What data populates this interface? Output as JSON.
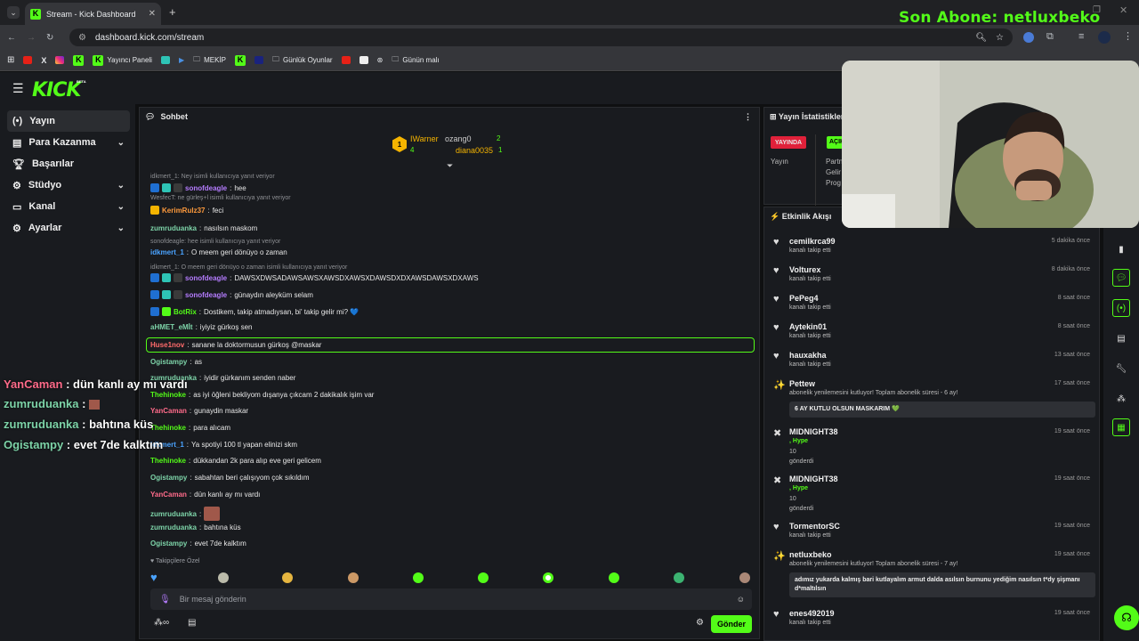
{
  "browser": {
    "tab_title": "Stream - Kick Dashboard",
    "url": "dashboard.kick.com/stream",
    "bookmarks": [
      "Yayıncı Paneli",
      "MEKİP",
      "Günlük Oyunlar",
      "Günün malı"
    ]
  },
  "overlay": {
    "last_sub": "Son Abone: netluxbeko",
    "chat": [
      {
        "user": "YanCaman",
        "text": "dün kanlı ay mı vardı",
        "color": "#ff6b8a"
      },
      {
        "user": "zumruduanka",
        "text": ":",
        "color": "#7dd3a8"
      },
      {
        "user": "zumruduanka",
        "text": "bahtına küs",
        "color": "#7dd3a8"
      },
      {
        "user": "Ogistampy",
        "text": "evet 7de kalktım",
        "color": "#7dd3a8"
      }
    ]
  },
  "kick": {
    "logo": "KICK",
    "logo_tag": "BETA"
  },
  "sidebar": {
    "items": [
      {
        "label": "Yayın",
        "icon": "broadcast-icon"
      },
      {
        "label": "Para Kazanma",
        "icon": "money-icon"
      },
      {
        "label": "Başarılar",
        "icon": "trophy-icon"
      },
      {
        "label": "Stüdyo",
        "icon": "gear-icon"
      },
      {
        "label": "Kanal",
        "icon": "channel-icon"
      },
      {
        "label": "Ayarlar",
        "icon": "settings-icon"
      }
    ]
  },
  "chat": {
    "title": "Sohbet",
    "leaderboard": {
      "rank1_name": "IWarner",
      "rank1_count": "4",
      "rank2_name": "ozang0",
      "rank2_count": "2",
      "rank3_name": "diana0035",
      "rank3_count": "1",
      "rank1_label": "1"
    },
    "messages": [
      {
        "type": "reply",
        "text": "idkmert_1: Ney isimli kullanıcıya yanıt veriyor"
      },
      {
        "type": "msg",
        "user": "sonofdeagle",
        "color": "#b57cff",
        "text": "hee",
        "badges": 3
      },
      {
        "type": "reply",
        "text": "WesfecT: ne gürleş+l isimli kullanıcıya yanıt veriyor"
      },
      {
        "type": "msg",
        "user": "KerimRulz37",
        "color": "#ff9a3c",
        "text": "feci",
        "badges": 1
      },
      {
        "type": "msg",
        "user": "zumruduanka",
        "color": "#7dd3a8",
        "text": "nasılsın maskom",
        "badges": 0
      },
      {
        "type": "reply",
        "text": "sonofdeagle: hee isimli kullanıcıya yanıt veriyor"
      },
      {
        "type": "msg",
        "user": "idkmert_1",
        "color": "#4aa3ff",
        "text": "O meem geri dönüyo o zaman",
        "badges": 0
      },
      {
        "type": "reply",
        "text": "idkmert_1: O meem geri dönüyo o zaman isimli kullanıcıya yanıt veriyor"
      },
      {
        "type": "msg",
        "user": "sonofdeagle",
        "color": "#b57cff",
        "text": "DAWSXDWSADAWSAWSXAWSDXAWSXDAWSDXDXAWSDAWSXDXAWS",
        "badges": 3
      },
      {
        "type": "msg",
        "user": "sonofdeagle",
        "color": "#b57cff",
        "text": "günaydın aleyküm selam",
        "badges": 3
      },
      {
        "type": "msg",
        "user": "BotRix",
        "color": "#53fc18",
        "text": "Dostikem, takip atmadıysan, bi' takip gelir mi? 💙",
        "badges": 2
      },
      {
        "type": "msg",
        "user": "aHMET_eMİt",
        "color": "#7dd3a8",
        "text": "iyiyiz gürkoş sen",
        "badges": 0
      },
      {
        "type": "msg",
        "user": "Huse1nov",
        "color": "#ff6b6b",
        "text": "sanane la doktormusun gürkoş @maskar",
        "badges": 0
      },
      {
        "type": "msg",
        "user": "Ogistampy",
        "color": "#7dd3a8",
        "text": "as",
        "badges": 0
      },
      {
        "type": "msg",
        "user": "zumruduanka",
        "color": "#7dd3a8",
        "text": "iyidir gürkanım senden naber",
        "badges": 0
      },
      {
        "type": "msg",
        "user": "Thehinoke",
        "color": "#53fc18",
        "text": "as iyi öğleni bekliyom dışanya çıkcam 2 dakikalık işim var",
        "badges": 0
      },
      {
        "type": "msg",
        "user": "YanCaman",
        "color": "#ff6b8a",
        "text": "gunaydin maskar",
        "badges": 0
      },
      {
        "type": "msg",
        "user": "Thehinoke",
        "color": "#53fc18",
        "text": "para alıcam",
        "badges": 0
      },
      {
        "type": "msg",
        "user": "idkmert_1",
        "color": "#4aa3ff",
        "text": "Ya spotiyi 100 tl yapan elinizi skm",
        "badges": 0
      },
      {
        "type": "msg",
        "user": "Thehinoke",
        "color": "#53fc18",
        "text": "dükkandan 2k para alıp eve geri gelicem",
        "badges": 0
      },
      {
        "type": "msg",
        "user": "Ogistampy",
        "color": "#7dd3a8",
        "text": "sabahtan beri çalışıyom çok sıkıldım",
        "badges": 0
      },
      {
        "type": "msg",
        "user": "YanCaman",
        "color": "#ff6b8a",
        "text": "dün kanlı ay mı vardı",
        "badges": 0
      },
      {
        "type": "msg",
        "user": "zumruduanka",
        "color": "#7dd3a8",
        "text": "",
        "badges": 0,
        "emote": true
      },
      {
        "type": "msg",
        "user": "zumruduanka",
        "color": "#7dd3a8",
        "text": "bahtına küs",
        "badges": 0
      },
      {
        "type": "msg",
        "user": "Ogistampy",
        "color": "#7dd3a8",
        "text": "evet 7de kalktım",
        "badges": 0
      }
    ],
    "followers_only": "Takipçilere Özel",
    "input_placeholder": "Bir mesaj gönderin",
    "send_label": "Gönder"
  },
  "stats": {
    "title": "Yayın İstatistikleri",
    "live_badge": "YAYINDA",
    "open_badge": "AÇIK",
    "label": "Yayın",
    "rows": [
      "Partn",
      "Gelir",
      "Prog"
    ]
  },
  "activity": {
    "title": "Etkinlik Akışı",
    "events": [
      {
        "name": "cemilkrca99",
        "sub": "kanalı takip etti",
        "time": "5 dakika önce",
        "icon": "heart-icon"
      },
      {
        "name": "Volturex",
        "sub": "kanalı takip etti",
        "time": "8 dakika önce",
        "icon": "heart-icon"
      },
      {
        "name": "PePeg4",
        "sub": "kanalı takip etti",
        "time": "8 saat önce",
        "icon": "heart-icon"
      },
      {
        "name": "Aytekin01",
        "sub": "kanalı takip etti",
        "time": "8 saat önce",
        "icon": "heart-icon"
      },
      {
        "name": "hauxakha",
        "sub": "kanalı takip etti",
        "time": "13 saat önce",
        "icon": "heart-icon"
      },
      {
        "name": "Pettew",
        "sub": "abonelik yenilemesini kutluyor! Toplam abonelik süresi - 6 ay!",
        "time": "17 saat önce",
        "icon": "party-icon",
        "quote": "6 AY KUTLU OLSUN MASKARIM 💚"
      },
      {
        "name": "MIDNIGHT38",
        "sub": ", Hype",
        "time": "19 saat önce",
        "icon": "x-icon",
        "amount": "10",
        "extra": "gönderdi"
      },
      {
        "name": "MIDNIGHT38",
        "sub": ", Hype",
        "time": "19 saat önce",
        "icon": "x-icon",
        "amount": "10",
        "extra": "gönderdi"
      },
      {
        "name": "TormentorSC",
        "sub": "kanalı takip etti",
        "time": "19 saat önce",
        "icon": "heart-icon"
      },
      {
        "name": "netluxbeko",
        "sub": "abonelik yenilemesini kutluyor! Toplam abonelik süresi - 7 ay!",
        "time": "19 saat önce",
        "icon": "party-icon",
        "quote": "adımız yukarda kalmış bari kutlayalım armut dalda asılsın burnunu yediğim nasılsın t*dy şişmanı d*maltılsın"
      },
      {
        "name": "enes492019",
        "sub": "kanalı takip etti",
        "time": "19 saat önce",
        "icon": "heart-icon"
      }
    ]
  },
  "colors": {
    "accent": "#53fc18",
    "panel": "#191b1f",
    "bg": "#0f1011"
  }
}
